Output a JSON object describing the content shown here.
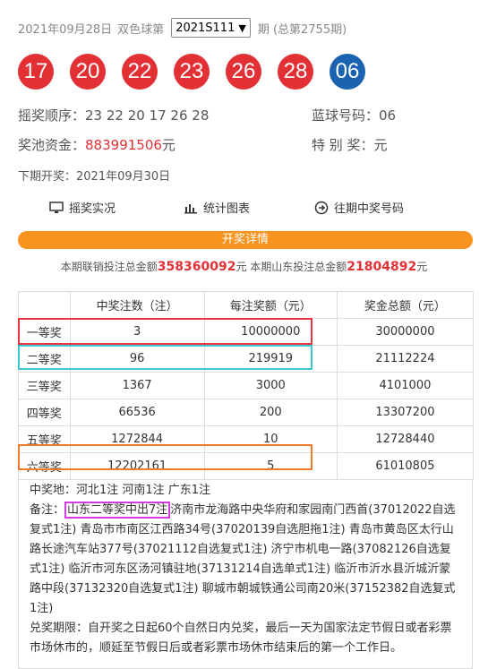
{
  "header": {
    "date": "2021年09月28日",
    "game": "双色球第",
    "issue_select": "2021S111",
    "suffix": "期 (总第2755期)"
  },
  "balls": {
    "red": [
      "17",
      "20",
      "22",
      "23",
      "26",
      "28"
    ],
    "blue": "06"
  },
  "info": {
    "order_label": "摇奖顺序：",
    "order_value": "23 22 20 17 26 28",
    "blue_label": "蓝球号码：",
    "blue_value": "06",
    "pool_label": "奖池资金：",
    "pool_value": "883991506",
    "pool_unit": "元",
    "special_label": "特 别 奖：",
    "special_value": "元",
    "next_label": "下期开奖：",
    "next_value": "2021年09月30日"
  },
  "links": {
    "live": "摇奖实况",
    "chart": "统计图表",
    "history": "往期中奖号码"
  },
  "detail_bar": "开奖详情",
  "summary": {
    "a": "本期联销投注总金额",
    "a_value": "358360092",
    "a_unit": "元 本期山东投注总金额",
    "b_value": "21804892",
    "b_unit": "元"
  },
  "table": {
    "headers": [
      "",
      "中奖注数（注）",
      "每注奖额（元）",
      "奖金总额（元）"
    ],
    "rows": [
      [
        "一等奖",
        "3",
        "10000000",
        "30000000"
      ],
      [
        "二等奖",
        "96",
        "219919",
        "21112224"
      ],
      [
        "三等奖",
        "1367",
        "3000",
        "4101000"
      ],
      [
        "四等奖",
        "66536",
        "200",
        "13307200"
      ],
      [
        "五等奖",
        "1272844",
        "10",
        "12728440"
      ],
      [
        "六等奖",
        "12202161",
        "5",
        "61010805"
      ]
    ]
  },
  "notes": {
    "region": "中奖地：河北1注 河南1注 广东1注",
    "remark_label": "备注：",
    "remark_highlight": "山东二等奖中出7注",
    "remark_text": "济南市龙海路中央华府和家园南门西首(37012022自选复式1注) 青岛市市南区江西路34号(37020139自选胆拖1注) 青岛市黄岛区太行山路长途汽车站377号(37021112自选复式1注) 济宁市机电一路(37082126自选复式1注) 临沂市河东区汤河镇驻地(37131214自选单式1注) 临沂市沂水县沂城沂蒙路中段(37132320自选复式1注) 聊城市朝城铁通公司南20米(37152382自选复式1注)",
    "deadline": "兑奖期限：自开奖之日起60个自然日内兑奖，最后一天为国家法定节假日或者彩票市场休市的，顺延至节假日后或者彩票市场休市结束后的第一个工作日。"
  },
  "colors": {
    "red": "#e23035",
    "blue": "#1b63b0",
    "orange": "#f7931e",
    "box_red": "#e8323c",
    "box_cyan": "#3cc8d2",
    "box_orange": "#f07a2a",
    "box_magenta": "#d43be0"
  }
}
